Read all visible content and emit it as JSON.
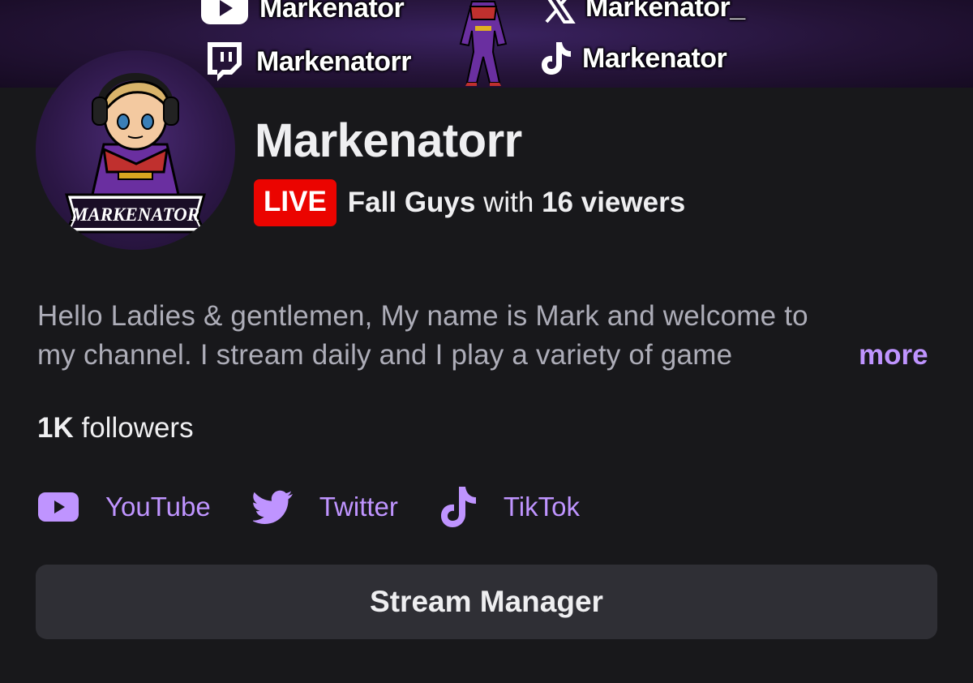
{
  "banner": {
    "handles": {
      "youtube": "Markenator",
      "x": "Markenator_",
      "twitch": "Markenatorr",
      "tiktok": "Markenator"
    }
  },
  "avatar": {
    "logo_text": "MARKENATOR"
  },
  "channel": {
    "name": "Markenatorr",
    "live_label": "LIVE",
    "game": "Fall Guys",
    "with_text": "with",
    "viewers": "16 viewers"
  },
  "description": {
    "line1": "Hello Ladies & gentlemen, My name is Mark and welcome to",
    "line2": "my channel. I stream daily and I play a variety of game",
    "more_label": "more"
  },
  "followers": {
    "count": "1K",
    "label": "followers"
  },
  "social_links": [
    {
      "label": "YouTube",
      "icon": "youtube-icon"
    },
    {
      "label": "Twitter",
      "icon": "twitter-icon"
    },
    {
      "label": "TikTok",
      "icon": "tiktok-icon"
    }
  ],
  "actions": {
    "stream_manager_label": "Stream Manager"
  },
  "colors": {
    "background": "#18181b",
    "accent": "#bf94ff",
    "live": "#eb0400",
    "button": "#2f2f35",
    "muted_text": "#adadb8"
  }
}
